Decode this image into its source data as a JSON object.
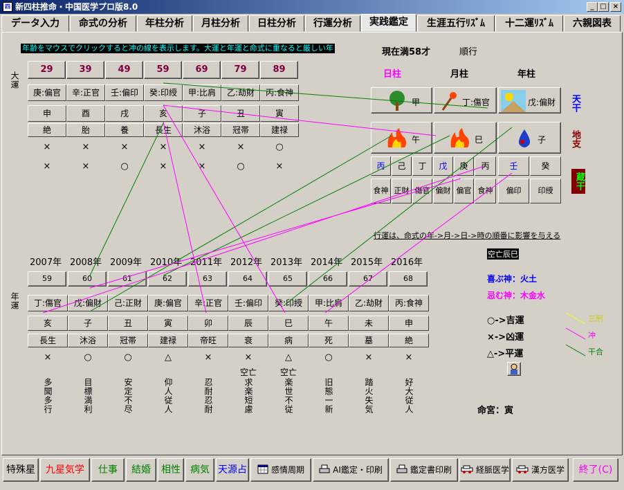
{
  "window": {
    "title": "新四柱推命・中国医学プロ版8.0",
    "icon_text": "四"
  },
  "tabs": [
    {
      "label": "データ入力"
    },
    {
      "label": "命式の分析"
    },
    {
      "label": "年柱分析"
    },
    {
      "label": "月柱分析"
    },
    {
      "label": "日柱分析"
    },
    {
      "label": "行運分析"
    },
    {
      "label": "実践鑑定"
    },
    {
      "label": "生涯五行ﾘｽﾞﾑ"
    },
    {
      "label": "十二運ﾘｽﾞﾑ"
    },
    {
      "label": "六親図表"
    }
  ],
  "notice": "年齢をマウスでクリックすると冲の線を表示します。大運と年運と命式に重なると厳しい年",
  "status": {
    "age": "現在満58才",
    "direction": "順行"
  },
  "pillars": {
    "day": "日柱",
    "month": "月柱",
    "year": "年柱"
  },
  "dayun": {
    "label": "大運",
    "columns": [
      {
        "age": "29",
        "kan": "庚:偏官",
        "shi": "申",
        "un": "絶",
        "m1": "×",
        "m2": "×"
      },
      {
        "age": "39",
        "kan": "辛:正官",
        "shi": "酉",
        "un": "胎",
        "m1": "×",
        "m2": "×"
      },
      {
        "age": "49",
        "kan": "壬:偏印",
        "shi": "戌",
        "un": "養",
        "m1": "×",
        "m2": "○"
      },
      {
        "age": "59",
        "kan": "癸:印綬",
        "shi": "亥",
        "un": "長生",
        "m1": "×",
        "m2": "×"
      },
      {
        "age": "69",
        "kan": "甲:比肩",
        "shi": "子",
        "un": "沐浴",
        "m1": "×",
        "m2": "×"
      },
      {
        "age": "79",
        "kan": "乙:劫財",
        "shi": "丑",
        "un": "冠帯",
        "m1": "×",
        "m2": "○"
      },
      {
        "age": "89",
        "kan": "丙:食神",
        "shi": "寅",
        "un": "建禄",
        "m1": "○",
        "m2": "×"
      }
    ]
  },
  "meishiki": {
    "tenkan": [
      {
        "text": "甲",
        "icon": "tree-icon"
      },
      {
        "text": "丁:傷官",
        "icon": "match-icon"
      },
      {
        "text": "戊:偏財",
        "icon": "sun-mountain-icon"
      }
    ],
    "chishi": [
      {
        "text": "午",
        "icon": "fire-icon"
      },
      {
        "text": "巳",
        "icon": "fire-icon"
      },
      {
        "text": "子",
        "icon": "water-drop-icon"
      }
    ],
    "zoukan": [
      {
        "text": "丙",
        "color": "#0000ff"
      },
      {
        "text": "己",
        "color": "#000000"
      },
      {
        "text": "丁",
        "color": "#000000"
      },
      {
        "text": "戊",
        "color": "#0000ff"
      },
      {
        "text": "庚",
        "color": "#000000"
      },
      {
        "text": "丙",
        "color": "#000000"
      },
      {
        "text": "壬",
        "color": "#0000ff"
      },
      {
        "text": "癸",
        "color": "#000000"
      }
    ],
    "tsuhen": [
      "食神",
      "正財",
      "傷官",
      "偏財",
      "偏官",
      "食神",
      "偏印",
      "印綬"
    ]
  },
  "side_labels": {
    "tenkan": "天干",
    "chishi": "地支",
    "zoukan": "蔵干"
  },
  "gyoun_note": "行運は、命式の年->月->日->時の順番に影響を与える",
  "kuubou": "空亡辰巳",
  "kishin": "喜ぶ神：火土",
  "imishin": "忌む神：木金水",
  "legend": [
    {
      "symbol": "○->吉運",
      "line_label": "三刑",
      "line_color": "#ffff00"
    },
    {
      "symbol": "×->凶運",
      "line_label": "冲",
      "line_color": "#ff00ff"
    },
    {
      "symbol": "△->平運",
      "line_label": "干合",
      "line_color": "#008000"
    }
  ],
  "meikyu": "命宮：寅",
  "nenun": {
    "label": "年運",
    "columns": [
      {
        "year": "2007年",
        "age": "59",
        "kan": "丁:傷官",
        "shi": "亥",
        "un": "長生",
        "mark": "×",
        "kuubou": "",
        "text": "多聞多行"
      },
      {
        "year": "2008年",
        "age": "60",
        "kan": "戊:偏財",
        "shi": "子",
        "un": "沐浴",
        "mark": "○",
        "kuubou": "",
        "text": "目標満利"
      },
      {
        "year": "2009年",
        "age": "61",
        "kan": "己:正財",
        "shi": "丑",
        "un": "冠帯",
        "mark": "○",
        "kuubou": "",
        "text": "安定不尽"
      },
      {
        "year": "2010年",
        "age": "62",
        "kan": "庚:偏官",
        "shi": "寅",
        "un": "建禄",
        "mark": "△",
        "kuubou": "",
        "text": "仰人従人"
      },
      {
        "year": "2011年",
        "age": "63",
        "kan": "辛:正官",
        "shi": "卯",
        "un": "帝旺",
        "mark": "×",
        "kuubou": "",
        "text": "忍耐忍耐"
      },
      {
        "year": "2012年",
        "age": "64",
        "kan": "壬:偏印",
        "shi": "辰",
        "un": "衰",
        "mark": "×",
        "kuubou": "空亡",
        "text": "求楽短慮"
      },
      {
        "year": "2013年",
        "age": "65",
        "kan": "癸:印綬",
        "shi": "巳",
        "un": "病",
        "mark": "△",
        "kuubou": "空亡",
        "text": "楽世不従"
      },
      {
        "year": "2014年",
        "age": "66",
        "kan": "甲:比肩",
        "shi": "午",
        "un": "死",
        "mark": "○",
        "kuubou": "",
        "text": "旧態一新"
      },
      {
        "year": "2015年",
        "age": "67",
        "kan": "乙:劫財",
        "shi": "未",
        "un": "墓",
        "mark": "×",
        "kuubou": "",
        "text": "踏火失気"
      },
      {
        "year": "2016年",
        "age": "68",
        "kan": "丙:食神",
        "shi": "申",
        "un": "絶",
        "mark": "×",
        "kuubou": "",
        "text": "好大従人"
      }
    ]
  },
  "bottom_buttons": [
    {
      "label": "特殊星",
      "color": "#000000",
      "icon": ""
    },
    {
      "label": "九星気学",
      "color": "#ff0000",
      "icon": ""
    },
    {
      "label": "仕事",
      "color": "#008000",
      "icon": ""
    },
    {
      "label": "結婚",
      "color": "#008000",
      "icon": ""
    },
    {
      "label": "相性",
      "color": "#008000",
      "icon": ""
    },
    {
      "label": "病気",
      "color": "#008000",
      "icon": ""
    },
    {
      "label": "天源占",
      "color": "#0000ff",
      "icon": ""
    },
    {
      "label": "感情周期",
      "color": "#000000",
      "icon": "calendar-icon"
    },
    {
      "label": "AI鑑定・印刷",
      "color": "#000000",
      "icon": "printer-icon"
    },
    {
      "label": "鑑定書印刷",
      "color": "#000000",
      "icon": "printer-icon"
    },
    {
      "label": "経脈医学",
      "color": "#000000",
      "icon": "car-icon"
    },
    {
      "label": "漢方医学",
      "color": "#000000",
      "icon": "car-icon"
    },
    {
      "label": "終了(C)",
      "color": "#ff00ff",
      "icon": ""
    }
  ]
}
